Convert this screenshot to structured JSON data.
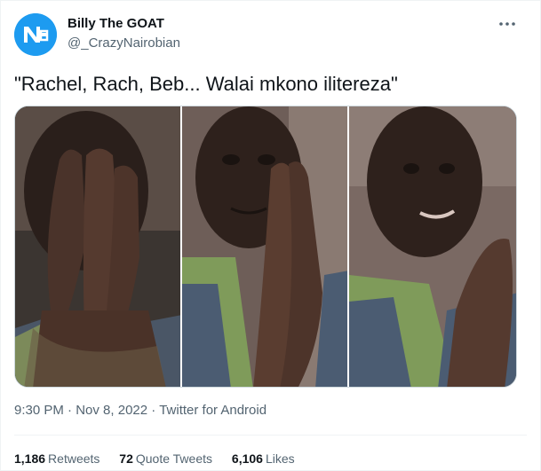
{
  "author": {
    "display_name": "Billy The GOAT",
    "handle": "@_CrazyNairobian",
    "avatar_icon": "nairobi-logo-icon",
    "avatar_color": "#1d9bf0"
  },
  "menu": {
    "icon": "more-horizontal-icon"
  },
  "tweet": {
    "text": "\"Rachel, Rach, Beb... Walai mkono ilitereza\""
  },
  "media": {
    "panels": [
      {
        "description": "man covering face with hands"
      },
      {
        "description": "man with praying hands"
      },
      {
        "description": "man speaking with hands raised"
      }
    ]
  },
  "meta": {
    "time": "9:30 PM",
    "separator": "·",
    "date": "Nov 8, 2022",
    "source": "Twitter for Android"
  },
  "stats": {
    "retweets_count": "1,186",
    "retweets_label": "Retweets",
    "quotes_count": "72",
    "quotes_label": "Quote Tweets",
    "likes_count": "6,106",
    "likes_label": "Likes"
  }
}
